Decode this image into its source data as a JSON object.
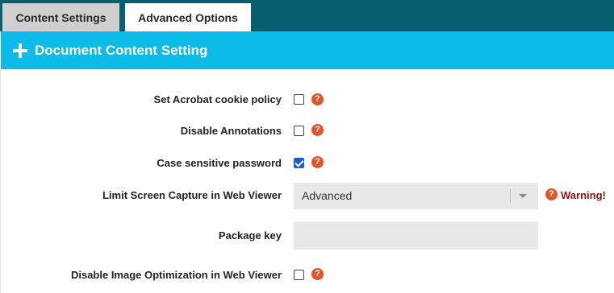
{
  "tabs": [
    {
      "label": "Content Settings",
      "active": false
    },
    {
      "label": "Advanced Options",
      "active": true
    }
  ],
  "section": {
    "title": "Document Content Setting",
    "icon": "plus-icon"
  },
  "rows": {
    "cookie_policy": {
      "label": "Set Acrobat cookie policy",
      "checked": false
    },
    "disable_annotations": {
      "label": "Disable Annotations",
      "checked": false
    },
    "case_sensitive": {
      "label": "Case sensitive password",
      "checked": true
    },
    "screen_capture": {
      "label": "Limit Screen Capture in Web Viewer",
      "selected": "Advanced",
      "warning": "Warning!"
    },
    "package_key": {
      "label": "Package key",
      "value": ""
    },
    "image_optimization": {
      "label": "Disable Image Optimization in Web Viewer",
      "checked": false
    }
  },
  "help_glyph": "?",
  "colors": {
    "tabbar": "#075e6e",
    "header": "#0cbbe8",
    "help": "#e0552a",
    "warning": "#8a1410",
    "checked": "#1b5fcc"
  }
}
